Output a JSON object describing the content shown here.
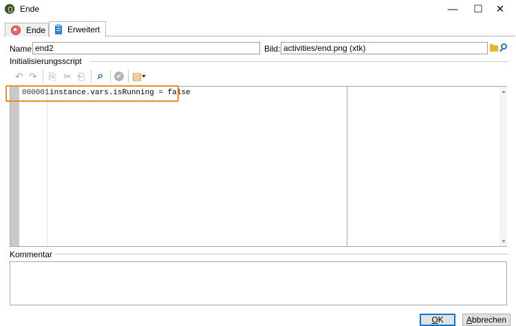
{
  "window": {
    "title": "Ende",
    "minimize_glyph": "—",
    "maximize_glyph": "☐",
    "close_glyph": "✕"
  },
  "tabs": [
    {
      "label": "Ende",
      "icon": "stop-icon",
      "active": false
    },
    {
      "label": "Erweitert",
      "icon": "clipboard-icon",
      "active": true
    }
  ],
  "form": {
    "name_label": "Name:",
    "name_value": "end2",
    "bild_label": "Bild:",
    "bild_value": "activities/end.png (xtk)"
  },
  "script_section": {
    "label": "Initialisierungsscript"
  },
  "toolbar": {
    "undo_glyph": "↶",
    "redo_glyph": "↷",
    "copy_glyph": "⎘",
    "cut_glyph": "✂",
    "paste_glyph": "⎗",
    "find_glyph": "⌕",
    "check_glyph": "✔",
    "insert_glyph": "▤"
  },
  "editor": {
    "lines": [
      {
        "number": "000001",
        "text": "instance.vars.isRunning = false"
      }
    ]
  },
  "comment_section": {
    "label": "Kommentar"
  },
  "buttons": {
    "ok_underline": "O",
    "ok_rest": "K",
    "cancel_underline": "A",
    "cancel_rest": "bbrechen"
  },
  "colors": {
    "highlight": "#ee8a22",
    "ok_border": "#0078d7"
  }
}
